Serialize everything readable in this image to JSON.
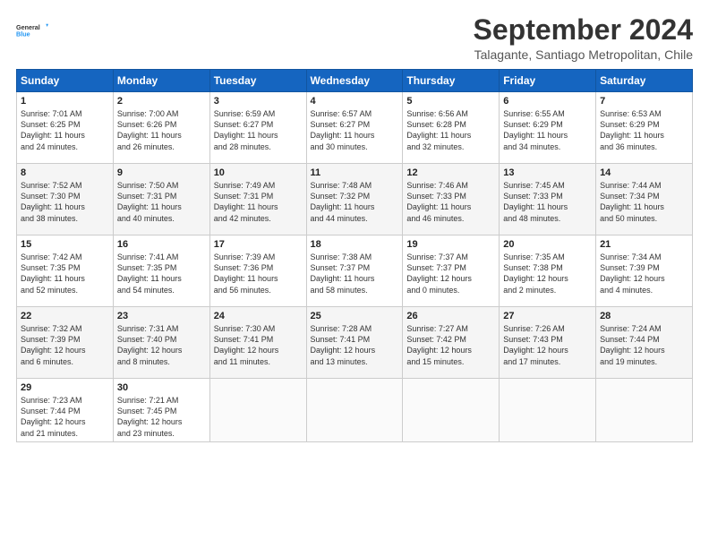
{
  "header": {
    "logo_line1": "General",
    "logo_line2": "Blue",
    "month": "September 2024",
    "location": "Talagante, Santiago Metropolitan, Chile"
  },
  "weekdays": [
    "Sunday",
    "Monday",
    "Tuesday",
    "Wednesday",
    "Thursday",
    "Friday",
    "Saturday"
  ],
  "weeks": [
    [
      {
        "day": "1",
        "content": "Sunrise: 7:01 AM\nSunset: 6:25 PM\nDaylight: 11 hours\nand 24 minutes."
      },
      {
        "day": "2",
        "content": "Sunrise: 7:00 AM\nSunset: 6:26 PM\nDaylight: 11 hours\nand 26 minutes."
      },
      {
        "day": "3",
        "content": "Sunrise: 6:59 AM\nSunset: 6:27 PM\nDaylight: 11 hours\nand 28 minutes."
      },
      {
        "day": "4",
        "content": "Sunrise: 6:57 AM\nSunset: 6:27 PM\nDaylight: 11 hours\nand 30 minutes."
      },
      {
        "day": "5",
        "content": "Sunrise: 6:56 AM\nSunset: 6:28 PM\nDaylight: 11 hours\nand 32 minutes."
      },
      {
        "day": "6",
        "content": "Sunrise: 6:55 AM\nSunset: 6:29 PM\nDaylight: 11 hours\nand 34 minutes."
      },
      {
        "day": "7",
        "content": "Sunrise: 6:53 AM\nSunset: 6:29 PM\nDaylight: 11 hours\nand 36 minutes."
      }
    ],
    [
      {
        "day": "8",
        "content": "Sunrise: 7:52 AM\nSunset: 7:30 PM\nDaylight: 11 hours\nand 38 minutes."
      },
      {
        "day": "9",
        "content": "Sunrise: 7:50 AM\nSunset: 7:31 PM\nDaylight: 11 hours\nand 40 minutes."
      },
      {
        "day": "10",
        "content": "Sunrise: 7:49 AM\nSunset: 7:31 PM\nDaylight: 11 hours\nand 42 minutes."
      },
      {
        "day": "11",
        "content": "Sunrise: 7:48 AM\nSunset: 7:32 PM\nDaylight: 11 hours\nand 44 minutes."
      },
      {
        "day": "12",
        "content": "Sunrise: 7:46 AM\nSunset: 7:33 PM\nDaylight: 11 hours\nand 46 minutes."
      },
      {
        "day": "13",
        "content": "Sunrise: 7:45 AM\nSunset: 7:33 PM\nDaylight: 11 hours\nand 48 minutes."
      },
      {
        "day": "14",
        "content": "Sunrise: 7:44 AM\nSunset: 7:34 PM\nDaylight: 11 hours\nand 50 minutes."
      }
    ],
    [
      {
        "day": "15",
        "content": "Sunrise: 7:42 AM\nSunset: 7:35 PM\nDaylight: 11 hours\nand 52 minutes."
      },
      {
        "day": "16",
        "content": "Sunrise: 7:41 AM\nSunset: 7:35 PM\nDaylight: 11 hours\nand 54 minutes."
      },
      {
        "day": "17",
        "content": "Sunrise: 7:39 AM\nSunset: 7:36 PM\nDaylight: 11 hours\nand 56 minutes."
      },
      {
        "day": "18",
        "content": "Sunrise: 7:38 AM\nSunset: 7:37 PM\nDaylight: 11 hours\nand 58 minutes."
      },
      {
        "day": "19",
        "content": "Sunrise: 7:37 AM\nSunset: 7:37 PM\nDaylight: 12 hours\nand 0 minutes."
      },
      {
        "day": "20",
        "content": "Sunrise: 7:35 AM\nSunset: 7:38 PM\nDaylight: 12 hours\nand 2 minutes."
      },
      {
        "day": "21",
        "content": "Sunrise: 7:34 AM\nSunset: 7:39 PM\nDaylight: 12 hours\nand 4 minutes."
      }
    ],
    [
      {
        "day": "22",
        "content": "Sunrise: 7:32 AM\nSunset: 7:39 PM\nDaylight: 12 hours\nand 6 minutes."
      },
      {
        "day": "23",
        "content": "Sunrise: 7:31 AM\nSunset: 7:40 PM\nDaylight: 12 hours\nand 8 minutes."
      },
      {
        "day": "24",
        "content": "Sunrise: 7:30 AM\nSunset: 7:41 PM\nDaylight: 12 hours\nand 11 minutes."
      },
      {
        "day": "25",
        "content": "Sunrise: 7:28 AM\nSunset: 7:41 PM\nDaylight: 12 hours\nand 13 minutes."
      },
      {
        "day": "26",
        "content": "Sunrise: 7:27 AM\nSunset: 7:42 PM\nDaylight: 12 hours\nand 15 minutes."
      },
      {
        "day": "27",
        "content": "Sunrise: 7:26 AM\nSunset: 7:43 PM\nDaylight: 12 hours\nand 17 minutes."
      },
      {
        "day": "28",
        "content": "Sunrise: 7:24 AM\nSunset: 7:44 PM\nDaylight: 12 hours\nand 19 minutes."
      }
    ],
    [
      {
        "day": "29",
        "content": "Sunrise: 7:23 AM\nSunset: 7:44 PM\nDaylight: 12 hours\nand 21 minutes."
      },
      {
        "day": "30",
        "content": "Sunrise: 7:21 AM\nSunset: 7:45 PM\nDaylight: 12 hours\nand 23 minutes."
      },
      {
        "day": "",
        "content": ""
      },
      {
        "day": "",
        "content": ""
      },
      {
        "day": "",
        "content": ""
      },
      {
        "day": "",
        "content": ""
      },
      {
        "day": "",
        "content": ""
      }
    ]
  ]
}
